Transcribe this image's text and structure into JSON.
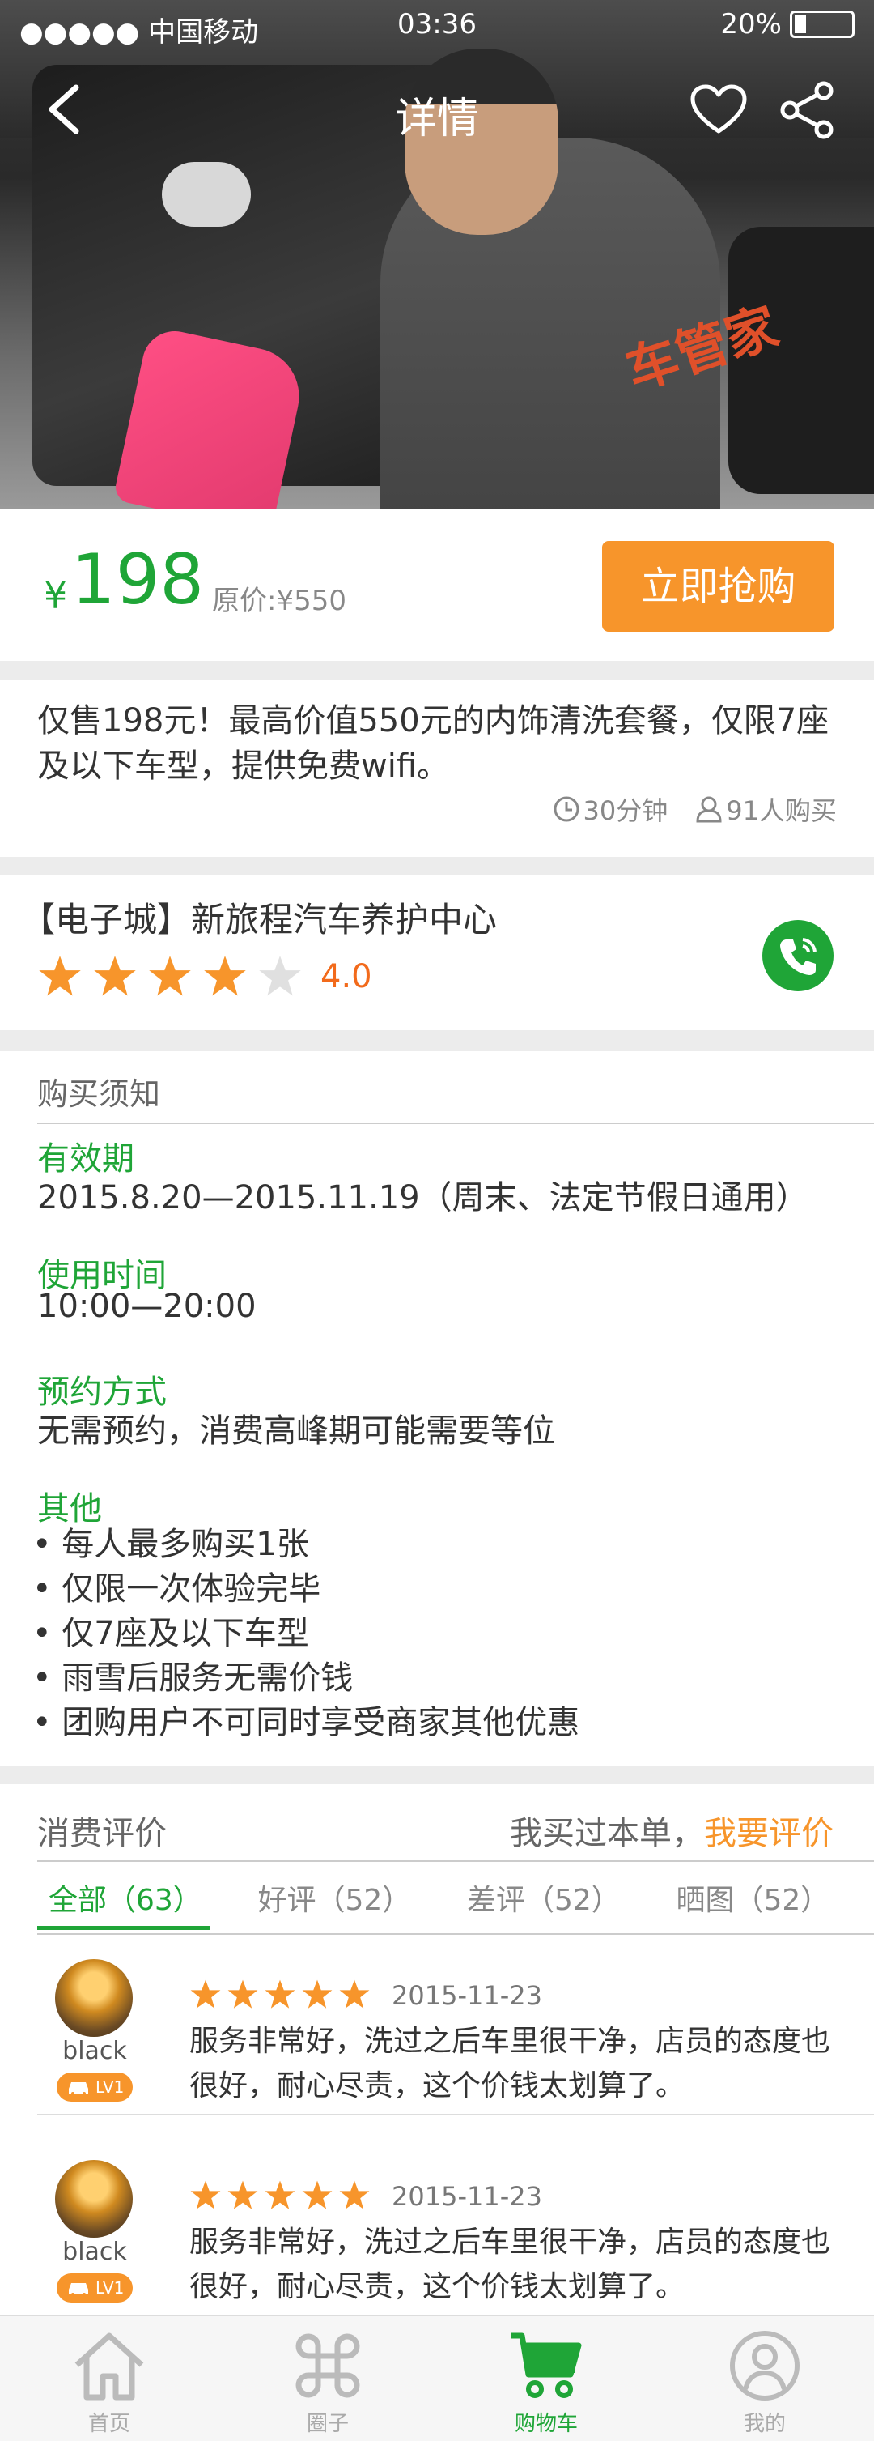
{
  "status_bar": {
    "carrier": "●●●●● 中国移动",
    "time": "03:36",
    "battery": "20%"
  },
  "navbar": {
    "title": "详情"
  },
  "price": {
    "currency": "¥",
    "value": "198",
    "original": "原价:¥550",
    "buy_label": "立即抢购"
  },
  "description": {
    "text": "仅售198元！最高价值550元的内饰清洗套餐，仅限7座及以下车型，提供免费wifi。",
    "duration": "30分钟",
    "buyers": "91人购买"
  },
  "shop": {
    "name": "【电子城】新旅程汽车养护中心",
    "rating": "4.0",
    "stars": 4
  },
  "notice": {
    "title": "购买须知",
    "validity_label": "有效期",
    "validity_text": "2015.8.20—2015.11.19（周末、法定节假日通用）",
    "hours_label": "使用时间",
    "hours_text": "10:00—20:00",
    "booking_label": "预约方式",
    "booking_text": "无需预约，消费高峰期可能需要等位",
    "other_label": "其他",
    "other_items": [
      "• 每人最多购买1张",
      "• 仅限一次体验完毕",
      "• 仅7座及以下车型",
      "• 雨雪后服务无需价钱",
      "• 团购用户不可同时享受商家其他优惠"
    ]
  },
  "reviews": {
    "title": "消费评价",
    "cta_prefix": "我买过本单，",
    "cta_link": "我要评价",
    "tabs": [
      "全部（63）",
      "好评（52）",
      "差评（52）",
      "晒图（52）"
    ],
    "items": [
      {
        "user": "black",
        "level": "LV1",
        "date": "2015-11-23",
        "stars": 5,
        "text": "服务非常好，洗过之后车里很干净，店员的态度也很好，耐心尽责，这个价钱太划算了。"
      },
      {
        "user": "black",
        "level": "LV1",
        "date": "2015-11-23",
        "stars": 5,
        "text": "服务非常好，洗过之后车里很干净，店员的态度也很好，耐心尽责，这个价钱太划算了。"
      }
    ]
  },
  "hero": {
    "logo_text": "车管家"
  },
  "tabbar": [
    {
      "label": "首页",
      "icon": "home-icon"
    },
    {
      "label": "圈子",
      "icon": "command-icon"
    },
    {
      "label": "购物车",
      "icon": "cart-icon",
      "active": true
    },
    {
      "label": "我的",
      "icon": "user-icon"
    }
  ],
  "colors": {
    "accent_green": "#1fa537",
    "accent_orange": "#f7952b",
    "rating_red": "#f26a1b"
  }
}
